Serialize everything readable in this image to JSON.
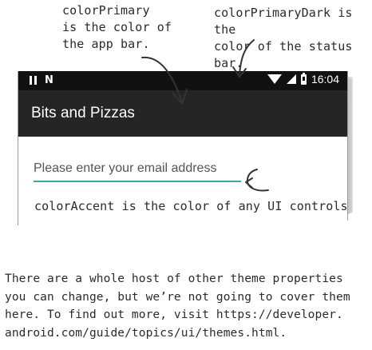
{
  "annotations": {
    "color_primary": "colorPrimary\nis the color of\nthe app bar.",
    "color_primary_dark": "colorPrimaryDark is the\ncolor of the status bar.",
    "color_accent": "colorAccent is the color of any UI controls.",
    "footer": "There are a whole host of other theme properties\nyou can change, but we’re not going to cover them\nhere. To find out more, visit https://developer.\nandroid.com/guide/topics/ui/themes.html."
  },
  "status_bar": {
    "time": "16:04",
    "left_icons": [
      "pause-icon",
      "n-icon"
    ],
    "right_icons": [
      "wifi-icon",
      "signal-icon",
      "battery-icon"
    ],
    "background": "#111111"
  },
  "app_bar": {
    "title": "Bits and Pizzas",
    "background": "#252525"
  },
  "email_field": {
    "value": "",
    "placeholder": "Please enter your email address",
    "accent_color": "#3aa8a0"
  }
}
